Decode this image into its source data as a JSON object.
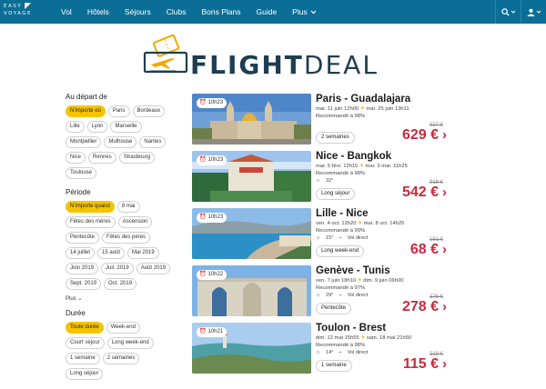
{
  "nav": {
    "logo_line1": "EASY",
    "logo_line2": "VOYAGE",
    "items": [
      {
        "label": "Vol"
      },
      {
        "label": "Hôtels"
      },
      {
        "label": "Séjours"
      },
      {
        "label": "Clubs"
      },
      {
        "label": "Bons Plans"
      },
      {
        "label": "Guide"
      },
      {
        "label": "Plus"
      }
    ],
    "search_icon": "search-icon",
    "user_icon": "user-icon"
  },
  "brand": {
    "title_bold": "FLIGHT",
    "title_light": "DEAL",
    "accent": "#f2a900",
    "color": "#1d3e52"
  },
  "filters": {
    "depart": {
      "label": "Au départ de",
      "options": [
        "N'importe où",
        "Paris",
        "Bordeaux",
        "Lille",
        "Lyon",
        "Marseille",
        "Montpellier",
        "Mulhouse",
        "Nantes",
        "Nice",
        "Rennes",
        "Strasbourg",
        "Toulouse"
      ],
      "selected": "N'importe où"
    },
    "periode": {
      "label": "Période",
      "options": [
        "N'importe quand",
        "8 mai",
        "Fêtes des mères",
        "Ascension",
        "Pentecôte",
        "Fêtes des pères",
        "14 juillet",
        "15 août",
        "Mai 2019",
        "Juin 2019",
        "Juil. 2019",
        "Août 2019",
        "Sept. 2019",
        "Oct. 2019"
      ],
      "selected": "N'importe quand",
      "more_label": "Plus"
    },
    "duree": {
      "label": "Durée",
      "options": [
        "Toute durée",
        "Week-end",
        "Court séjour",
        "Long week-end",
        "1 semaine",
        "2 semaines",
        "Long séjour"
      ],
      "selected": "Toute durée"
    }
  },
  "deals": [
    {
      "time": "10h23",
      "title": "Paris - Guadalajara",
      "dates_out": "mar. 11 juin 12h00",
      "dates_ret": "mar. 25 juin 13h11",
      "rec": "Recommandé à 98%",
      "temp": "",
      "direct": "",
      "tag": "2 semaines",
      "old_price": "927 €",
      "price": "629 €"
    },
    {
      "time": "10h23",
      "title": "Nice - Bangkok",
      "dates_out": "mar. 5 févr. 12h15",
      "dates_ret": "mar. 3 mar. 11h25",
      "rec": "Recommandé à 98%",
      "temp": "32°",
      "direct": "",
      "tag": "Long séjour",
      "old_price": "918 €",
      "price": "542 €"
    },
    {
      "time": "10h23",
      "title": "Lille - Nice",
      "dates_out": "ven. 4 oct. 12h20",
      "dates_ret": "mar. 8 oct. 14h25",
      "rec": "Recommandé à 99%",
      "temp": "15°",
      "direct": "Vol direct",
      "tag": "Long week-end",
      "old_price": "151 €",
      "price": "68 €"
    },
    {
      "time": "10h22",
      "title": "Genève - Tunis",
      "dates_out": "ven. 7 juin 18h10",
      "dates_ret": "dim. 9 juin 06h00",
      "rec": "Recommandé à 97%",
      "temp": "29°",
      "direct": "Vol direct",
      "tag": "Pentecôte",
      "old_price": "376 €",
      "price": "278 €"
    },
    {
      "time": "10h21",
      "title": "Toulon - Brest",
      "dates_out": "dim. 12 mai 15h55",
      "dates_ret": "sam. 18 mai 21h50",
      "rec": "Recommandé à 98%",
      "temp": "14°",
      "direct": "Vol direct",
      "tag": "1 semaine",
      "old_price": "219 €",
      "price": "115 €"
    }
  ]
}
